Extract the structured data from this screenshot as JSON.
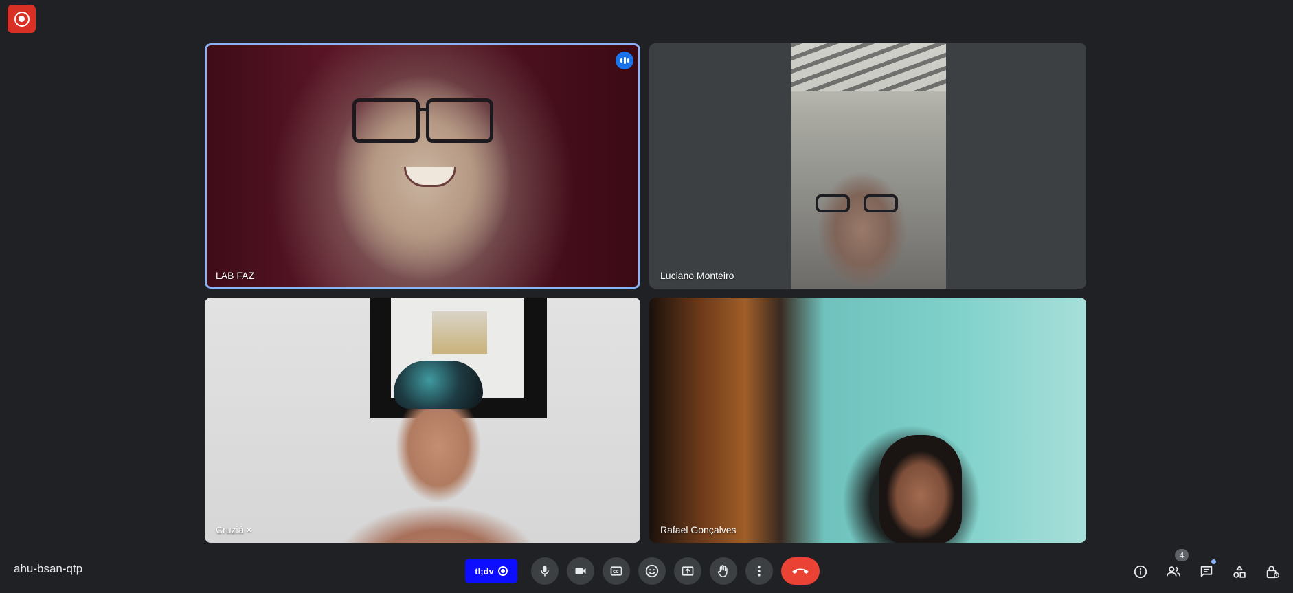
{
  "meeting": {
    "code": "ahu-bsan-qtp"
  },
  "participants": [
    {
      "name": "LAB FAZ",
      "speaking": true
    },
    {
      "name": "Luciano Monteiro",
      "speaking": false
    },
    {
      "name": "Cruziá ×",
      "speaking": false
    },
    {
      "name": "Rafael Gonçalves",
      "speaking": false
    }
  ],
  "toolbar": {
    "extension_label": "tl;dv",
    "people_count": "4"
  },
  "icons": [
    "record-icon",
    "microphone-icon",
    "camera-icon",
    "captions-icon",
    "emoji-icon",
    "present-icon",
    "raise-hand-icon",
    "more-options-icon",
    "end-call-icon",
    "info-icon",
    "people-icon",
    "chat-icon",
    "activities-icon",
    "host-controls-icon",
    "speaking-indicator-icon"
  ],
  "colors": {
    "background": "#202124",
    "record_indicator": "#d93025",
    "speaking_border": "#8ab4f8",
    "extension_button": "#0d0dff",
    "end_call": "#ea4335",
    "control_button": "#3c4043"
  }
}
